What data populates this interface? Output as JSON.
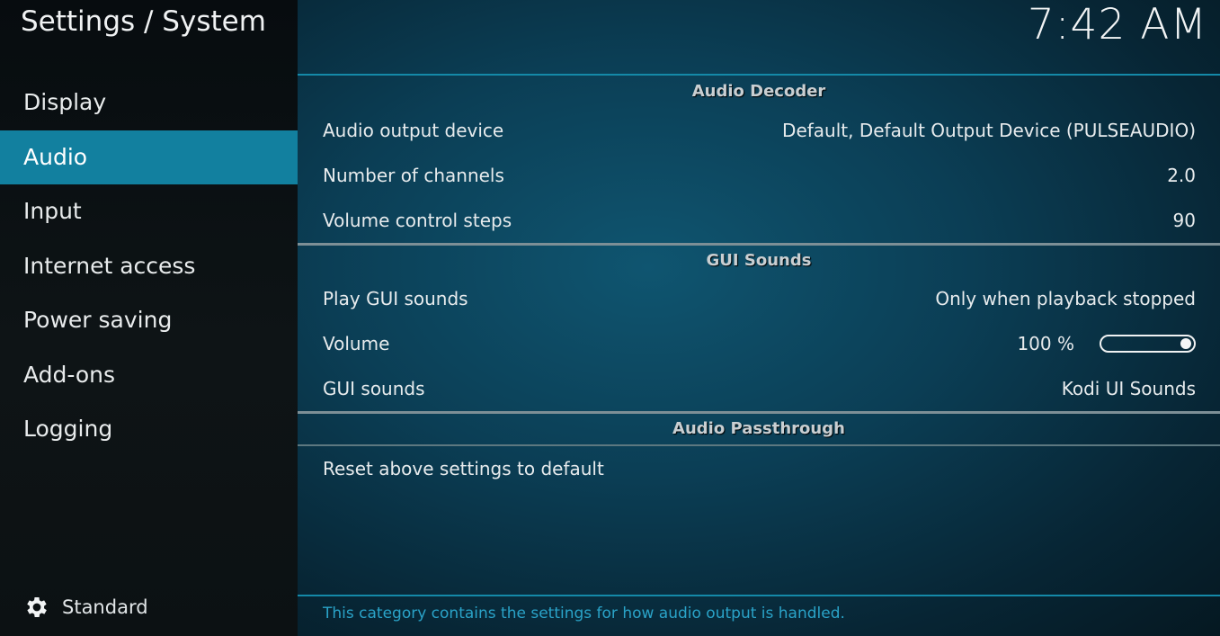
{
  "header": {
    "title": "Settings / System",
    "clock": "7:42 AM"
  },
  "sidebar": {
    "items": [
      {
        "label": "Display",
        "active": false
      },
      {
        "label": "Audio",
        "active": true
      },
      {
        "label": "Input",
        "active": false
      },
      {
        "label": "Internet access",
        "active": false
      },
      {
        "label": "Power saving",
        "active": false
      },
      {
        "label": "Add-ons",
        "active": false
      },
      {
        "label": "Logging",
        "active": false
      }
    ],
    "settings_level": {
      "icon": "gear-icon",
      "label": "Standard"
    }
  },
  "sections": {
    "audio_decoder": {
      "title": "Audio Decoder",
      "rows": [
        {
          "label": "Audio output device",
          "value": "Default, Default Output Device (PULSEAUDIO)"
        },
        {
          "label": "Number of channels",
          "value": "2.0"
        },
        {
          "label": "Volume control steps",
          "value": "90"
        }
      ]
    },
    "gui_sounds": {
      "title": "GUI Sounds",
      "rows": [
        {
          "label": "Play GUI sounds",
          "value": "Only when playback stopped"
        },
        {
          "label": "Volume",
          "value": "100 %",
          "slider_percent": 100
        },
        {
          "label": "GUI sounds",
          "value": "Kodi UI Sounds"
        }
      ]
    },
    "audio_passthrough": {
      "title": "Audio Passthrough",
      "rows": [
        {
          "label": "Reset above settings to default"
        }
      ]
    }
  },
  "description": "This category contains the settings for how audio output is handled.",
  "colors": {
    "accent": "#12809f",
    "description_text": "#2aa3c8"
  }
}
